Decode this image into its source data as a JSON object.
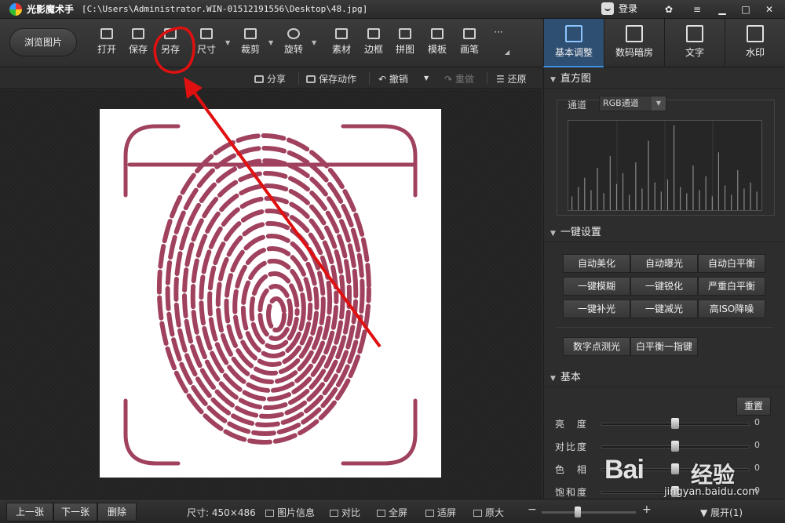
{
  "titlebar": {
    "app_name": "光影魔术手",
    "path": "[C:\\Users\\Administrator.WIN-01512191556\\Desktop\\48.jpg]",
    "login": "登录"
  },
  "toolbar": {
    "browse": "浏览图片",
    "open": "打开",
    "save": "保存",
    "save_as": "另存",
    "size": "尺寸",
    "crop": "裁剪",
    "rotate": "旋转",
    "material": "素材",
    "border": "边框",
    "collage": "拼图",
    "template": "模板",
    "brush": "画笔",
    "more": "···"
  },
  "module_tabs": {
    "basic": "基本调整",
    "darkroom": "数码暗房",
    "text": "文字",
    "watermark": "水印"
  },
  "subbar": {
    "share": "分享",
    "save_action": "保存动作",
    "undo": "撤销",
    "redo": "重做",
    "restore": "还原"
  },
  "panel": {
    "histogram_title": "直方图",
    "channel_label": "通道",
    "channel_value": "RGB通道",
    "oneclick_title": "一键设置",
    "buttons": [
      "自动美化",
      "自动曝光",
      "自动白平衡",
      "一键模糊",
      "一键锐化",
      "严重白平衡",
      "一键补光",
      "一键减光",
      "高ISO降噪"
    ],
    "extra_buttons": [
      "数字点测光",
      "白平衡一指键"
    ],
    "basic_title": "基本",
    "reset": "重置",
    "sliders": [
      {
        "label": "亮 度",
        "value": "0"
      },
      {
        "label": "对比度",
        "value": "0"
      },
      {
        "label": "色 相",
        "value": "0"
      },
      {
        "label": "饱和度",
        "value": "0"
      }
    ]
  },
  "statusbar": {
    "prev": "上一张",
    "next": "下一张",
    "delete": "删除",
    "size_label": "尺寸: 450×486",
    "info": "图片信息",
    "compare": "对比",
    "fullscreen": "全屏",
    "fit": "适屏",
    "original": "原大",
    "expand": "展开(1)"
  },
  "watermark": {
    "main": "Bai",
    "cn": "经验",
    "url": "jingyan.baidu.com"
  },
  "colors": {
    "fingerprint": "#a0415e",
    "annotation": "#e01010",
    "active_tab": "#2f4f72"
  },
  "histogram": {
    "channel": "RGB",
    "bars": [
      18,
      30,
      42,
      26,
      55,
      22,
      70,
      34,
      48,
      20,
      62,
      28,
      90,
      36,
      24,
      40,
      110,
      30,
      22,
      58,
      26,
      44,
      18,
      75,
      32,
      20,
      52,
      28,
      36,
      24
    ]
  }
}
